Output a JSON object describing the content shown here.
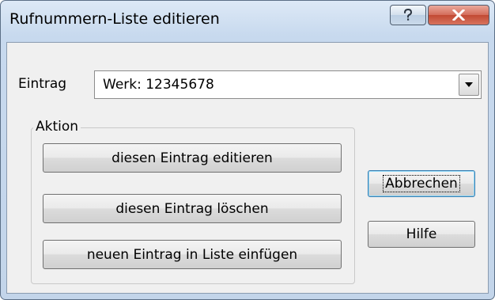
{
  "window": {
    "title": "Rufnummern-Liste editieren",
    "help_button_icon": "question-mark-icon",
    "close_button_icon": "close-x-icon"
  },
  "entry": {
    "label": "Eintrag",
    "selected_value": "Werk: 12345678",
    "dropdown_icon": "chevron-down-icon"
  },
  "action_group": {
    "label": "Aktion",
    "buttons": [
      {
        "label": "diesen Eintrag editieren"
      },
      {
        "label": "diesen Eintrag löschen"
      },
      {
        "label": "neuen Eintrag in Liste einfügen"
      }
    ]
  },
  "side_buttons": {
    "cancel_label": "Abbrechen",
    "help_label": "Hilfe"
  },
  "colors": {
    "title_bar": "#c7d9ee",
    "close_button": "#c14a33",
    "dialog_face": "#f0f0f0",
    "default_button_border": "#3c7fb1"
  }
}
